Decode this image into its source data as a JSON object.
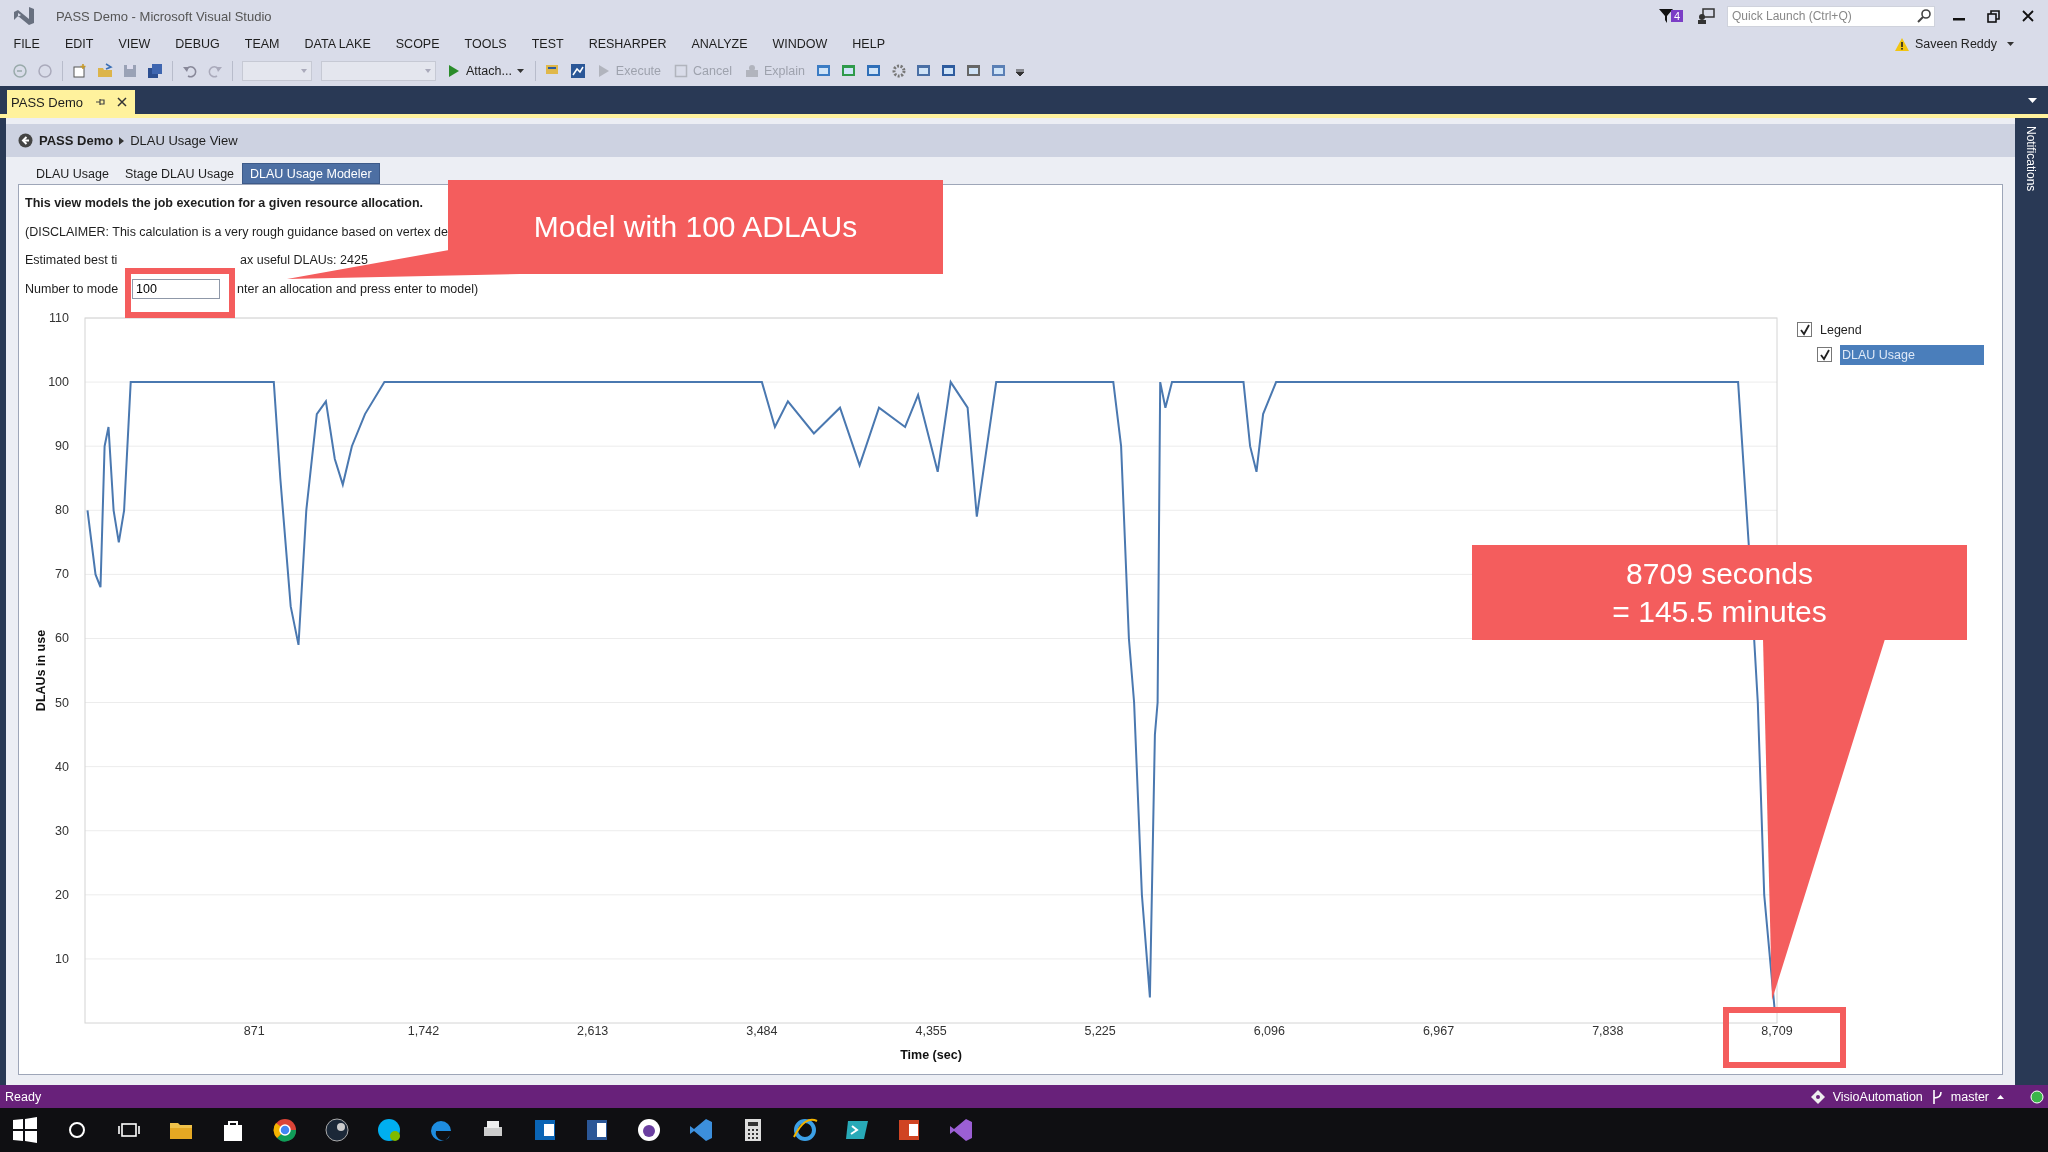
{
  "window": {
    "title": "PASS Demo - Microsoft Visual Studio"
  },
  "title_bar": {
    "notification_count": "4",
    "quick_launch": {
      "placeholder": "Quick Launch (Ctrl+Q)"
    },
    "user": "Saveen Reddy"
  },
  "menu": [
    "FILE",
    "EDIT",
    "VIEW",
    "DEBUG",
    "TEAM",
    "DATA LAKE",
    "SCOPE",
    "TOOLS",
    "TEST",
    "RESHARPER",
    "ANALYZE",
    "WINDOW",
    "HELP"
  ],
  "toolbar": [
    {
      "kind": "split-run",
      "label": "Attach...",
      "disabled": false
    },
    {
      "kind": "run",
      "label": "Execute",
      "disabled": true
    },
    {
      "kind": "stop",
      "label": "Cancel",
      "disabled": true
    },
    {
      "kind": "explain",
      "label": "Explain",
      "disabled": true
    }
  ],
  "document_tabs": [
    {
      "label": "PASS Demo",
      "selected": true
    }
  ],
  "breadcrumb": [
    "PASS Demo",
    "DLAU Usage View"
  ],
  "view_tabs": [
    {
      "label": "DLAU Usage",
      "selected": false
    },
    {
      "label": "Stage DLAU Usage",
      "selected": false
    },
    {
      "label": "DLAU Usage Modeler",
      "selected": true
    }
  ],
  "description": {
    "heading": "This view models the job execution for a given resource allocation.",
    "disclaimer": "(DISCLAIMER: This calculation is a very rough guidance based on vertex de",
    "estimate": [
      "Estimated best ti",
      "ax useful DLAUs: 2425"
    ]
  },
  "model_input": {
    "label": "Number to mode",
    "value": "100",
    "hint": "nter an allocation and press enter to model)"
  },
  "chart": {
    "chart_data": {
      "type": "line",
      "grid": true,
      "xlabel": "Time (sec)",
      "ylabel": "DLAUs in use",
      "xlim": [
        0,
        8709
      ],
      "ylim": [
        0,
        110
      ],
      "x": [
        13,
        54,
        80,
        101,
        121,
        147,
        174,
        201,
        235,
        500,
        700,
        972,
        1005,
        1059,
        1099,
        1139,
        1193,
        1240,
        1286,
        1327,
        1374,
        1441,
        1541,
        2000,
        2600,
        3484,
        3551,
        3618,
        3752,
        3886,
        3987,
        4087,
        4221,
        4288,
        4389,
        4456,
        4543,
        4590,
        4690,
        5000,
        5293,
        5333,
        5373,
        5400,
        5440,
        5481,
        5507,
        5521,
        5534,
        5561,
        5595,
        5963,
        5997,
        6030,
        6064,
        6131,
        7000,
        8000,
        8509,
        8563,
        8610,
        8643,
        8697
      ],
      "series": [
        {
          "name": "DLAU Usage",
          "color": "#4a78b0",
          "values": [
            80,
            70,
            68,
            90,
            93,
            80,
            75,
            80,
            100,
            100,
            100,
            100,
            85,
            65,
            59,
            80,
            95,
            97,
            88,
            84,
            90,
            95,
            100,
            100,
            100,
            100,
            93,
            97,
            92,
            96,
            87,
            96,
            93,
            98,
            86,
            100,
            96,
            79,
            100,
            100,
            100,
            90,
            60,
            50,
            20,
            4,
            45,
            50,
            100,
            96,
            100,
            100,
            90,
            86,
            95,
            100,
            100,
            100,
            100,
            75,
            50,
            20,
            2
          ]
        }
      ],
      "yticks": [
        10,
        20,
        30,
        40,
        50,
        60,
        70,
        80,
        90,
        100,
        110
      ],
      "xticks": [
        {
          "value": 871,
          "label": "871"
        },
        {
          "value": 1742,
          "label": "1,742"
        },
        {
          "value": 2613,
          "label": "2,613"
        },
        {
          "value": 3484,
          "label": "3,484"
        },
        {
          "value": 4355,
          "label": "4,355"
        },
        {
          "value": 5225,
          "label": "5,225"
        },
        {
          "value": 6096,
          "label": "6,096"
        },
        {
          "value": 6967,
          "label": "6,967"
        },
        {
          "value": 7838,
          "label": "7,838"
        },
        {
          "value": 8709,
          "label": "8,709"
        }
      ]
    },
    "legend": {
      "label": "Legend",
      "checked": true,
      "items": [
        {
          "checked": true,
          "selected": true
        }
      ]
    }
  },
  "callouts": [
    {
      "lines": [
        "Model with 100 ADLAUs"
      ]
    },
    {
      "lines": [
        "8709 seconds",
        "= 145.5 minutes"
      ]
    }
  ],
  "side_panel": {
    "label": "Notifications"
  },
  "status_bar": {
    "text": "Ready",
    "project": "VisioAutomation",
    "branch": "master"
  }
}
